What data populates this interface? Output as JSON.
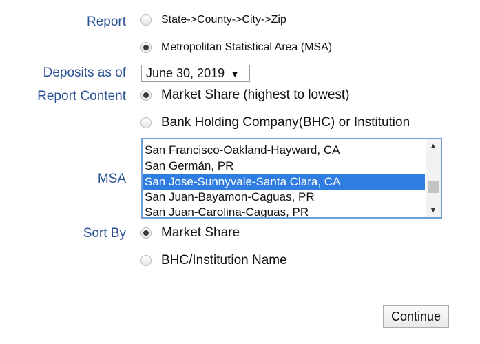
{
  "labels": {
    "report": "Report",
    "deposits_as_of": "Deposits as of",
    "report_content": "Report Content",
    "msa": "MSA",
    "sort_by": "Sort By"
  },
  "report_options": [
    {
      "label": "State->County->City->Zip",
      "checked": false
    },
    {
      "label": "Metropolitan Statistical Area (MSA)",
      "checked": true
    }
  ],
  "deposits_date": {
    "selected": "June 30, 2019",
    "arrow": "▼"
  },
  "content_options": [
    {
      "label": "Market Share (highest to lowest)",
      "checked": true
    },
    {
      "label": "Bank Holding Company(BHC) or Institution",
      "checked": false
    }
  ],
  "msa_list": {
    "items": [
      "San Francisco-Oakland-Hayward, CA",
      "San Germán, PR",
      "San Jose-Sunnyvale-Santa Clara, CA",
      "San Juan-Bayamon-Caguas, PR",
      "San Juan-Carolina-Caguas, PR"
    ],
    "selected_index": 2,
    "scroll_up": "▲",
    "scroll_down": "▼"
  },
  "sort_options": [
    {
      "label": "Market Share",
      "checked": true
    },
    {
      "label": "BHC/Institution Name",
      "checked": false
    }
  ],
  "continue_label": "Continue"
}
